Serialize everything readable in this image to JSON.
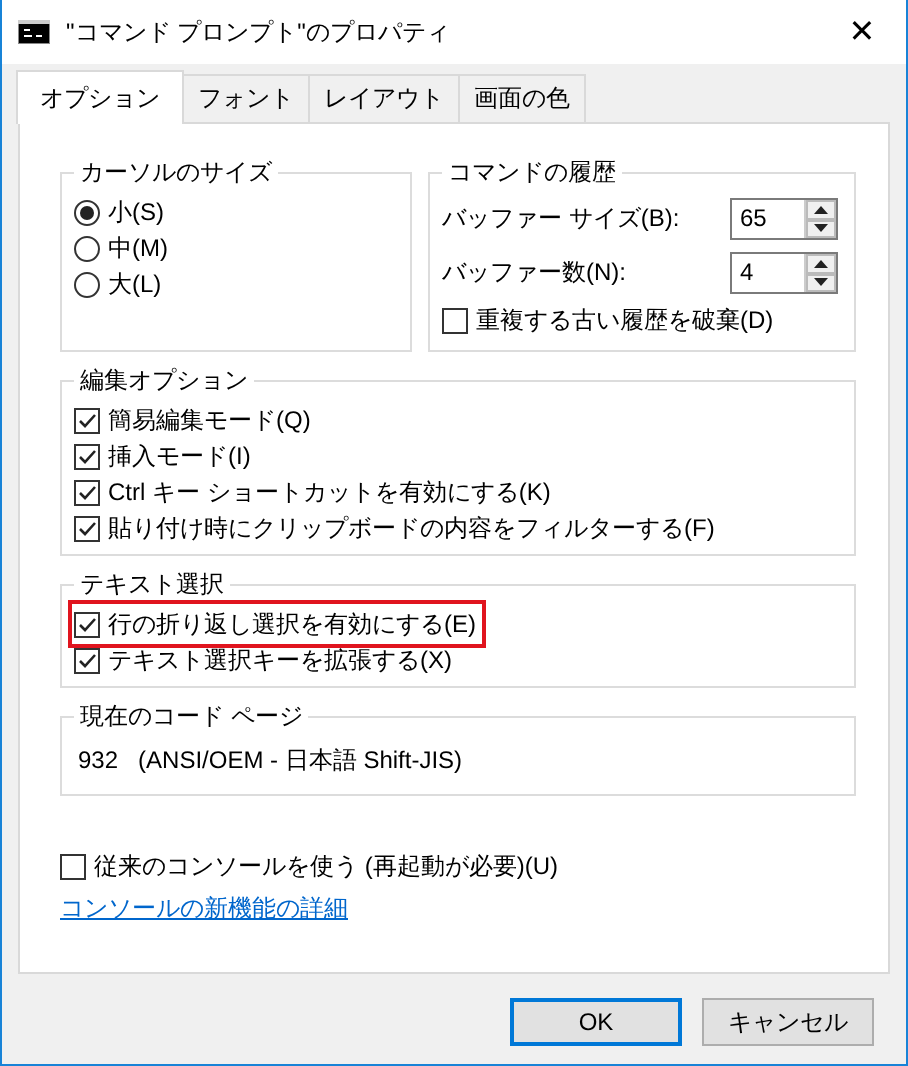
{
  "window": {
    "title": "\"コマンド プロンプト\"のプロパティ",
    "close": "✕"
  },
  "tabs": [
    {
      "label": "オプション",
      "selected": true
    },
    {
      "label": "フォント",
      "selected": false
    },
    {
      "label": "レイアウト",
      "selected": false
    },
    {
      "label": "画面の色",
      "selected": false
    }
  ],
  "cursor_size": {
    "title": "カーソルのサイズ",
    "options": [
      {
        "label": "小(S)",
        "selected": true
      },
      {
        "label": "中(M)",
        "selected": false
      },
      {
        "label": "大(L)",
        "selected": false
      }
    ]
  },
  "command_history": {
    "title": "コマンドの履歴",
    "spinners": [
      {
        "label": "バッファー サイズ(B):",
        "value": "65"
      },
      {
        "label": "バッファー数(N):",
        "value": "4"
      }
    ],
    "discard": {
      "label": "重複する古い履歴を破棄(D)",
      "checked": false
    }
  },
  "edit_options": {
    "title": "編集オプション",
    "items": [
      {
        "label": "簡易編集モード(Q)",
        "checked": true,
        "highlighted": false
      },
      {
        "label": "挿入モード(I)",
        "checked": true,
        "highlighted": false
      },
      {
        "label": "Ctrl キー ショートカットを有効にする(K)",
        "checked": true,
        "highlighted": false
      },
      {
        "label": "貼り付け時にクリップボードの内容をフィルターする(F)",
        "checked": true,
        "highlighted": false
      }
    ]
  },
  "text_selection": {
    "title": "テキスト選択",
    "items": [
      {
        "label": "行の折り返し選択を有効にする(E)",
        "checked": true,
        "highlighted": true
      },
      {
        "label": "テキスト選択キーを拡張する(X)",
        "checked": true,
        "highlighted": false
      }
    ]
  },
  "code_page": {
    "title": "現在のコード ページ",
    "value": "932   (ANSI/OEM - 日本語 Shift-JIS)"
  },
  "legacy_console": {
    "label": "従来のコンソールを使う (再起動が必要)(U)",
    "checked": false
  },
  "link": "コンソールの新機能の詳細",
  "buttons": [
    {
      "label": "OK",
      "default": true
    },
    {
      "label": "キャンセル",
      "default": false
    }
  ]
}
